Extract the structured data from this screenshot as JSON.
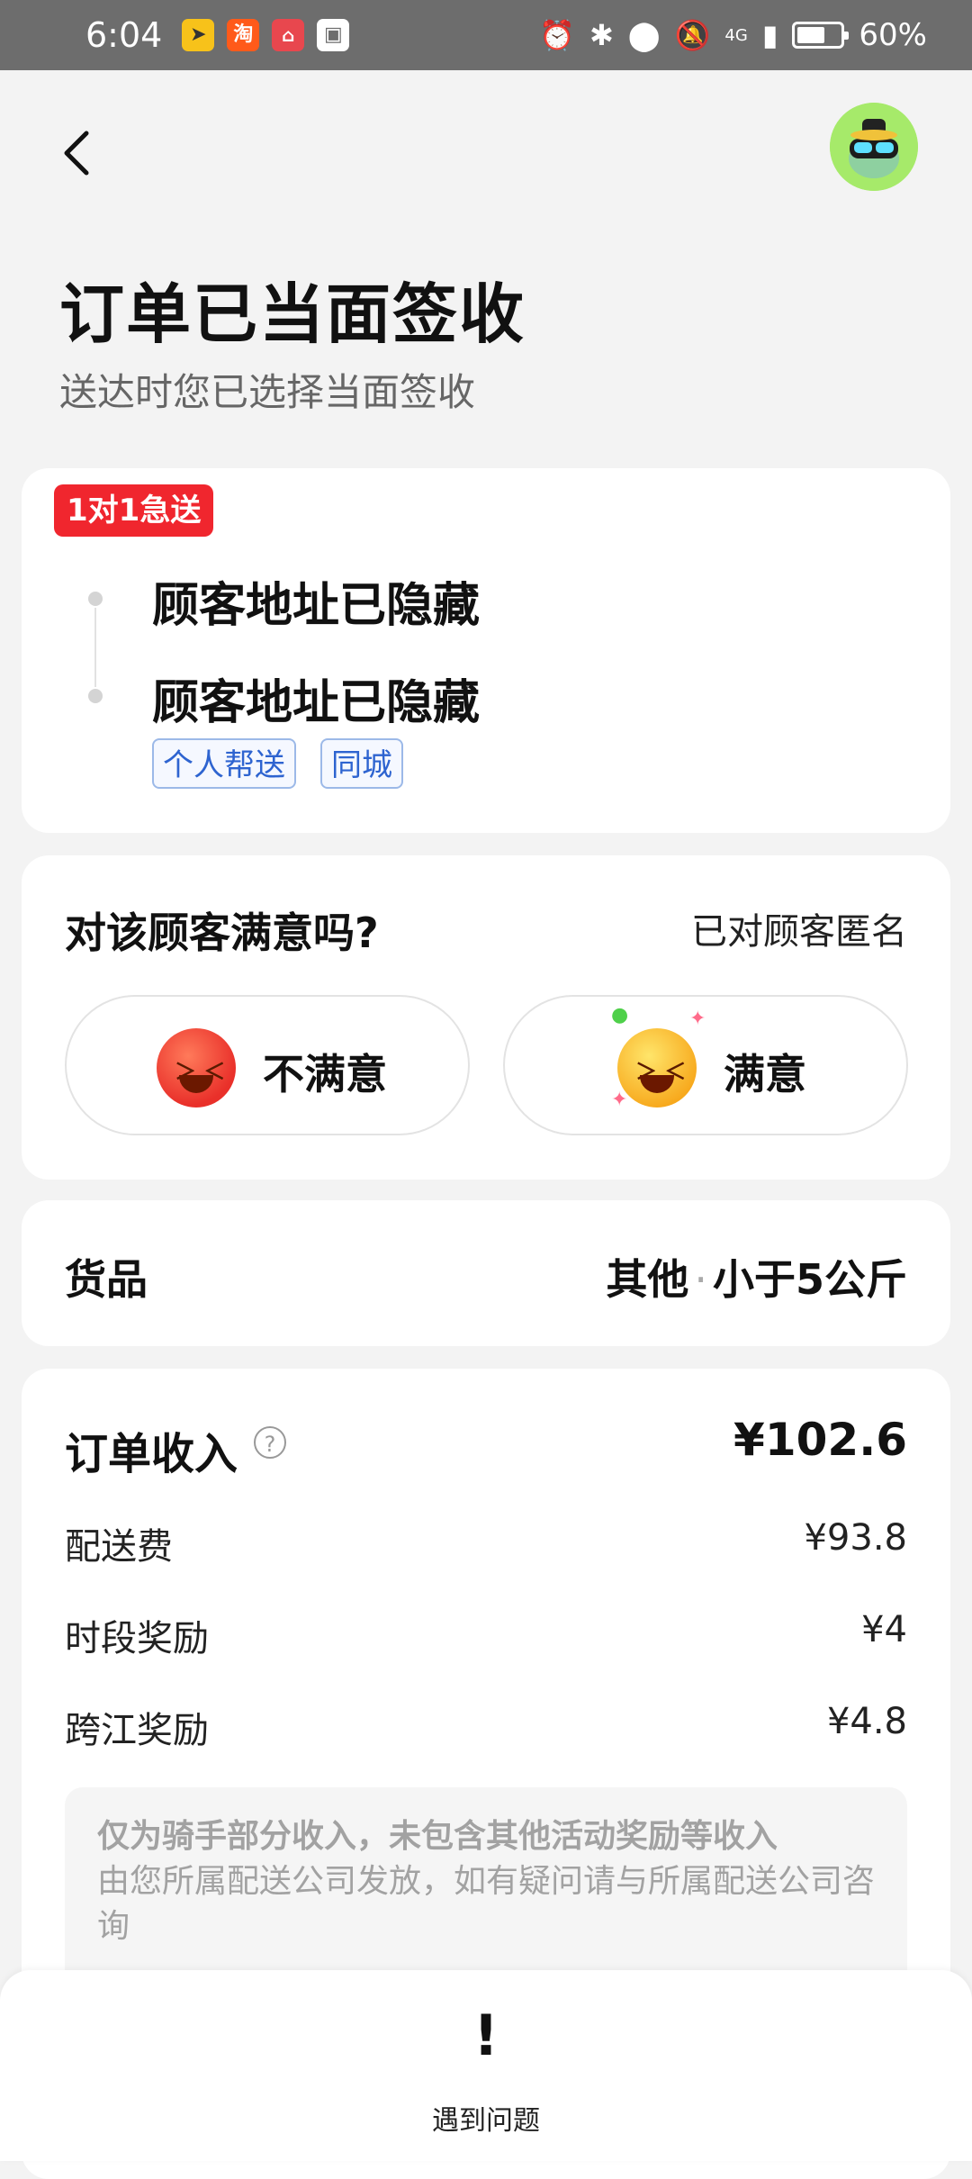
{
  "status_bar": {
    "time": "6:04",
    "apps": [
      {
        "icon": "notification-app-1-icon",
        "glyph": "",
        "color": "#f7c21a"
      },
      {
        "icon": "taobao-icon",
        "glyph": "淘",
        "color": "#ff5a1a"
      },
      {
        "icon": "huawei-store-icon",
        "glyph": "",
        "color": "#e8474e"
      },
      {
        "icon": "gallery-icon",
        "glyph": "",
        "color": "#ffffff"
      }
    ],
    "network": "4G",
    "battery": "60%"
  },
  "header": {
    "back_glyph": "‹",
    "title": "订单已当面签收",
    "subtitle": "送达时您已选择当面签收"
  },
  "route": {
    "tag": "1对1急送",
    "from_address": "顾客地址已隐藏",
    "to_address": "顾客地址已隐藏",
    "chips": [
      "个人帮送",
      "同城"
    ]
  },
  "satisfaction": {
    "question": "对该顾客满意吗?",
    "anonymous_note": "已对顾客匿名",
    "options": [
      {
        "label": "不满意",
        "icon": "angry-face-icon"
      },
      {
        "label": "满意",
        "icon": "laughing-face-icon"
      }
    ]
  },
  "goods": {
    "label": "货品",
    "category": "其他",
    "separator": "·",
    "weight": "小于5公斤"
  },
  "income": {
    "title": "订单收入",
    "help_glyph": "?",
    "total": "¥102.6",
    "items": [
      {
        "label": "配送费",
        "value": "¥93.8"
      },
      {
        "label": "时段奖励",
        "value": "¥4"
      },
      {
        "label": "跨江奖励",
        "value": "¥4.8"
      }
    ],
    "note_line1": "仅为骑手部分收入，未包含其他活动奖励等收入",
    "note_line2": "由您所属配送公司发放，如有疑问请与所属配送公司咨询"
  },
  "bottom_bar": {
    "icon_glyph": "!",
    "label": "遇到问题"
  }
}
